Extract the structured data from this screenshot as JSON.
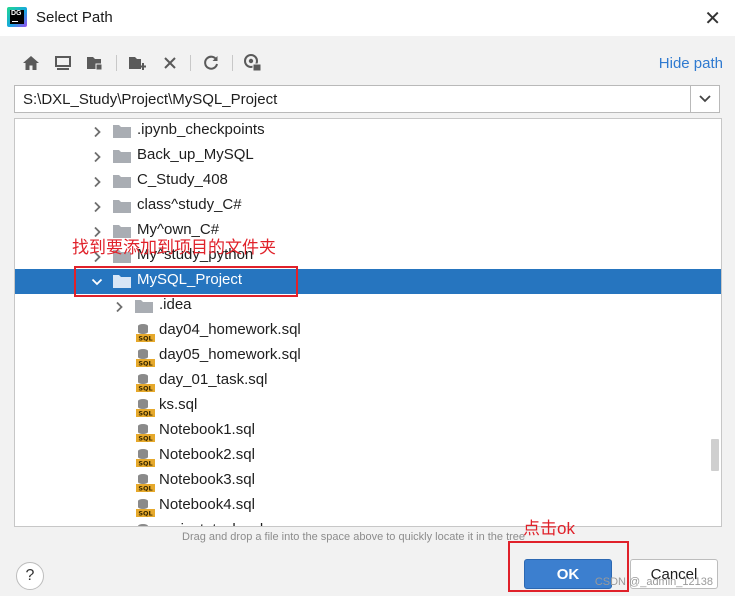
{
  "window": {
    "title": "Select Path",
    "app_icon_text": "DG"
  },
  "toolbar": {
    "icons": [
      "home-icon",
      "desktop-icon",
      "project-folder-icon",
      "new-folder-icon",
      "delete-icon",
      "refresh-icon",
      "show-hidden-icon"
    ],
    "hide_path_label": "Hide path"
  },
  "path": {
    "value": "S:\\DXL_Study\\Project\\MySQL_Project"
  },
  "tree": {
    "rows": [
      {
        "label": ".ipynb_checkpoints",
        "type": "folder",
        "expanded": false,
        "depth": 1
      },
      {
        "label": "Back_up_MySQL",
        "type": "folder",
        "expanded": false,
        "depth": 1
      },
      {
        "label": "C_Study_408",
        "type": "folder",
        "expanded": false,
        "depth": 1
      },
      {
        "label": "class^study_C#",
        "type": "folder",
        "expanded": false,
        "depth": 1
      },
      {
        "label": "My^own_C#",
        "type": "folder",
        "expanded": false,
        "depth": 1
      },
      {
        "label": "My^study_python",
        "type": "folder",
        "expanded": false,
        "depth": 1
      },
      {
        "label": "MySQL_Project",
        "type": "folder",
        "expanded": true,
        "depth": 1,
        "selected": true
      },
      {
        "label": ".idea",
        "type": "folder",
        "expanded": false,
        "depth": 2
      },
      {
        "label": "day04_homework.sql",
        "type": "sql",
        "depth": 2
      },
      {
        "label": "day05_homework.sql",
        "type": "sql",
        "depth": 2
      },
      {
        "label": "day_01_task.sql",
        "type": "sql",
        "depth": 2
      },
      {
        "label": "ks.sql",
        "type": "sql",
        "depth": 2
      },
      {
        "label": "Notebook1.sql",
        "type": "sql",
        "depth": 2
      },
      {
        "label": "Notebook2.sql",
        "type": "sql",
        "depth": 2
      },
      {
        "label": "Notebook3.sql",
        "type": "sql",
        "depth": 2
      },
      {
        "label": "Notebook4.sql",
        "type": "sql",
        "depth": 2
      },
      {
        "label": "project_task.sql",
        "type": "sql",
        "depth": 2
      }
    ]
  },
  "annotations": {
    "find_folder_text": "找到要添加到项目的文件夹",
    "click_ok_text": "点击ok"
  },
  "hint_text": "Drag and drop a file into the space above to quickly locate it in the tree",
  "buttons": {
    "help": "?",
    "ok": "OK",
    "cancel": "Cancel"
  },
  "watermark": "CSDN @_admin_12138",
  "colors": {
    "selection": "#2675bf",
    "accent_link": "#2f7ad0",
    "annotation": "#e0212a",
    "ok_button": "#3c7fcf"
  }
}
